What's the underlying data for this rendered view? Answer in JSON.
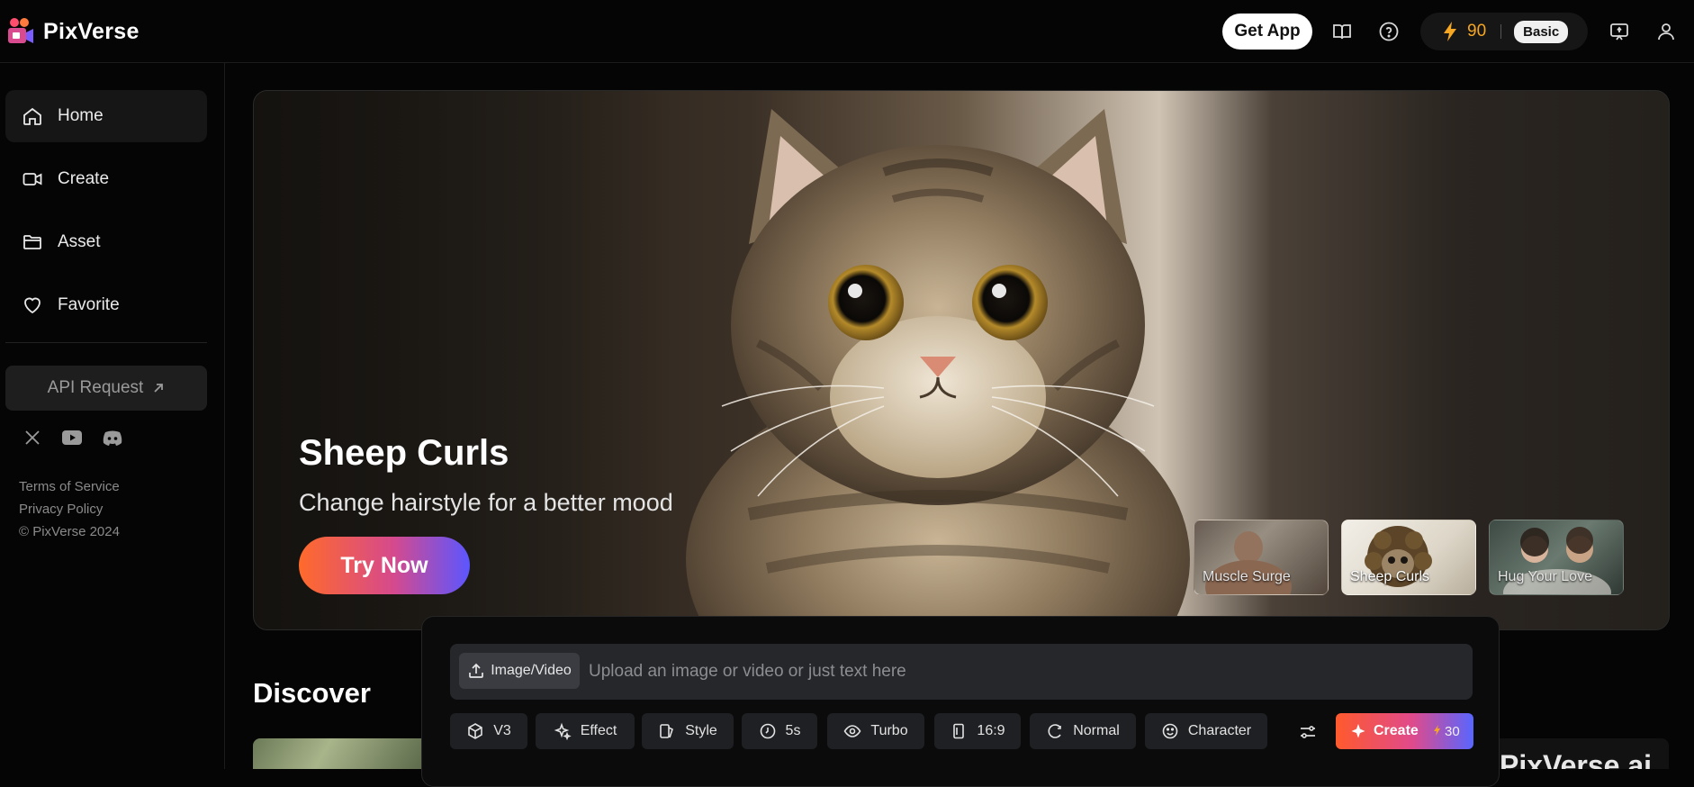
{
  "header": {
    "brand": "PixVerse",
    "get_app_label": "Get App",
    "credits": {
      "count": "90",
      "plan": "Basic"
    }
  },
  "sidebar": {
    "items": [
      {
        "label": "Home",
        "icon": "home-icon",
        "active": true
      },
      {
        "label": "Create",
        "icon": "video-camera-icon",
        "active": false
      },
      {
        "label": "Asset",
        "icon": "folder-icon",
        "active": false
      },
      {
        "label": "Favorite",
        "icon": "heart-icon",
        "active": false
      }
    ],
    "api_request_label": "API Request",
    "footer": {
      "terms": "Terms of Service",
      "privacy": "Privacy Policy",
      "copyright": "© PixVerse 2024"
    }
  },
  "hero": {
    "title": "Sheep Curls",
    "subtitle": "Change hairstyle for a better mood",
    "cta": "Try Now",
    "thumbnails": [
      {
        "label": "Muscle Surge",
        "active": false
      },
      {
        "label": "Sheep Curls",
        "active": true
      },
      {
        "label": "Hug Your Love",
        "active": false
      }
    ]
  },
  "discover": {
    "title": "Discover",
    "watermark_text": "PixVerse.ai"
  },
  "composer": {
    "upload_label": "Image/Video",
    "placeholder": "Upload an image or video or just text here",
    "options": [
      {
        "label": "V3",
        "icon": "cube-icon"
      },
      {
        "label": "Effect",
        "icon": "sparkle-icon"
      },
      {
        "label": "Style",
        "icon": "style-icon"
      },
      {
        "label": "5s",
        "icon": "timer-icon"
      },
      {
        "label": "Turbo",
        "icon": "eye-icon"
      },
      {
        "label": "16:9",
        "icon": "aspect-ratio-icon"
      },
      {
        "label": "Normal",
        "icon": "motion-icon"
      },
      {
        "label": "Character",
        "icon": "smiley-icon"
      }
    ],
    "create_label": "Create",
    "create_cost": "30"
  },
  "colors": {
    "accent_orange": "#ff5a2d",
    "accent_pink": "#e04a8a",
    "accent_blue": "#5866ff",
    "credit_gold": "#f5a623"
  }
}
